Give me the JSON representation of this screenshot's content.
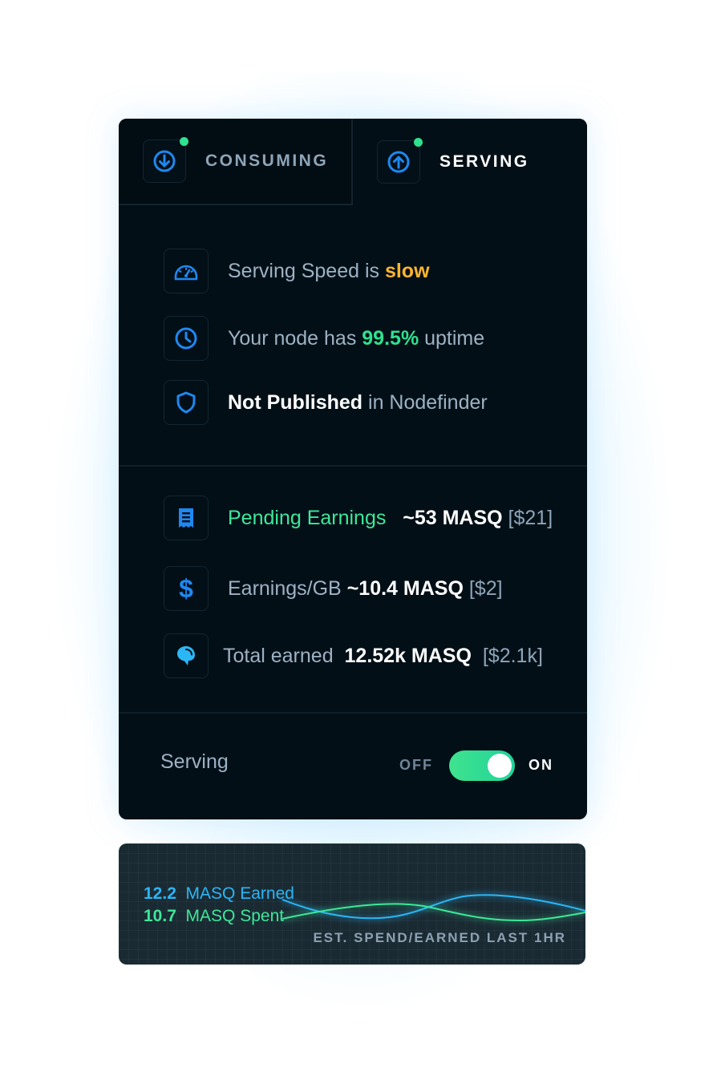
{
  "tabs": {
    "consuming": {
      "label": "CONSUMING",
      "icon": "arrow-down-circle-icon"
    },
    "serving": {
      "label": "SERVING",
      "icon": "arrow-up-circle-icon"
    }
  },
  "status": {
    "speed": {
      "prefix": "Serving Speed is ",
      "value": "slow",
      "icon": "speedometer-icon"
    },
    "uptime": {
      "prefix": "Your node has ",
      "value": "99.5%",
      "suffix": " uptime",
      "icon": "clock-icon"
    },
    "publish": {
      "value": "Not Published",
      "suffix": " in Nodefinder",
      "icon": "shield-icon"
    }
  },
  "earnings": {
    "pending": {
      "label": "Pending Earnings",
      "amount": "~53 MASQ",
      "usd": "[$21]",
      "icon": "receipt-icon"
    },
    "per_gb": {
      "label": "Earnings/GB",
      "amount": "~10.4 MASQ",
      "usd": "[$2]",
      "icon": "dollar-icon"
    },
    "total": {
      "label": "Total earned",
      "amount": "12.52k MASQ",
      "usd": "[$2.1k]",
      "icon": "masq-logo-icon"
    }
  },
  "footer": {
    "label": "Serving",
    "off_label": "OFF",
    "on_label": "ON",
    "toggle_on": true
  },
  "colors": {
    "accent_blue": "#1e88f0",
    "green": "#2ee28f",
    "orange": "#ffb52e",
    "card_bg": "#030f17"
  },
  "chart_data": {
    "type": "line",
    "series": [
      {
        "name": "MASQ Earned",
        "value_label": "12.2",
        "color": "#2bb6f5"
      },
      {
        "name": "MASQ Spent",
        "value_label": "10.7",
        "color": "#3de89a"
      }
    ],
    "caption": "EST. SPEND/EARNED LAST 1HR"
  }
}
